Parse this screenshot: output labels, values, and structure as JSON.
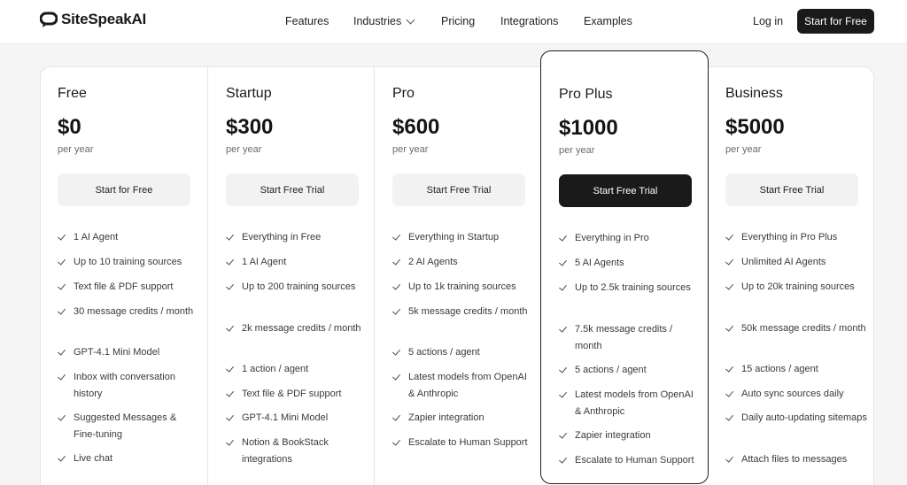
{
  "header": {
    "brand": "SiteSpeakAI",
    "nav": [
      "Features",
      "Industries",
      "Pricing",
      "Integrations",
      "Examples"
    ],
    "login": "Log in",
    "cta": "Start for Free"
  },
  "plans": [
    {
      "name": "Free",
      "price": "$0",
      "period": "per year",
      "button": "Start for Free",
      "features": [
        "1 AI Agent",
        "Up to 10 training sources",
        "Text file & PDF support",
        "30 message credits / month",
        "GPT-4.1 Mini Model",
        "Inbox with conversation history",
        "Suggested Messages & Fine-tuning",
        "Live chat"
      ]
    },
    {
      "name": "Startup",
      "price": "$300",
      "period": "per year",
      "button": "Start Free Trial",
      "features": [
        "Everything in Free",
        "1 AI Agent",
        "Up to 200 training sources",
        "2k message credits / month",
        "1 action / agent",
        "Text file & PDF support",
        "GPT-4.1 Mini Model",
        "Notion & BookStack integrations"
      ]
    },
    {
      "name": "Pro",
      "price": "$600",
      "period": "per year",
      "button": "Start Free Trial",
      "features": [
        "Everything in Startup",
        "2 AI Agents",
        "Up to 1k training sources",
        "5k message credits / month",
        "5 actions / agent",
        "Latest models from OpenAI & Anthropic",
        "Zapier integration",
        "Escalate to Human Support"
      ]
    },
    {
      "name": "Pro Plus",
      "price": "$1000",
      "period": "per year",
      "button": "Start Free Trial",
      "features": [
        "Everything in Pro",
        "5 AI Agents",
        "Up to 2.5k training sources",
        "7.5k message credits / month",
        "5 actions / agent",
        "Latest models from OpenAI & Anthropic",
        "Zapier integration",
        "Escalate to Human Support"
      ]
    },
    {
      "name": "Business",
      "price": "$5000",
      "period": "per year",
      "button": "Start Free Trial",
      "features": [
        "Everything in Pro Plus",
        "Unlimited AI Agents",
        "Up to 20k training sources",
        "50k message credits / month",
        "15 actions / agent",
        "Auto sync sources daily",
        "Daily auto-updating sitemaps",
        "Attach files to messages"
      ]
    }
  ]
}
